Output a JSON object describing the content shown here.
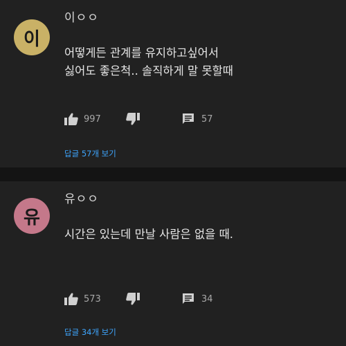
{
  "comments": [
    {
      "avatar_char": "이",
      "avatar_color": "#c9b166",
      "author": "이ㅇㅇ",
      "text": "어떻게든 관계를 유지하고싶어서\n싫어도 좋은척.. 솔직하게 말 못할때",
      "like_count": "997",
      "reply_count": "57",
      "view_replies": "답글 57개 보기"
    },
    {
      "avatar_char": "유",
      "avatar_color": "#c4788a",
      "author": "유ㅇㅇ",
      "text": "시간은 있는데 만날 사람은 없을 때.",
      "like_count": "573",
      "reply_count": "34",
      "view_replies": "답글 34개 보기"
    }
  ],
  "icons": {
    "like": "thumbs-up-icon",
    "dislike": "thumbs-down-icon",
    "reply": "comment-icon"
  },
  "colors": {
    "background": "#141414",
    "card": "#212121",
    "link": "#3ea6ff"
  }
}
